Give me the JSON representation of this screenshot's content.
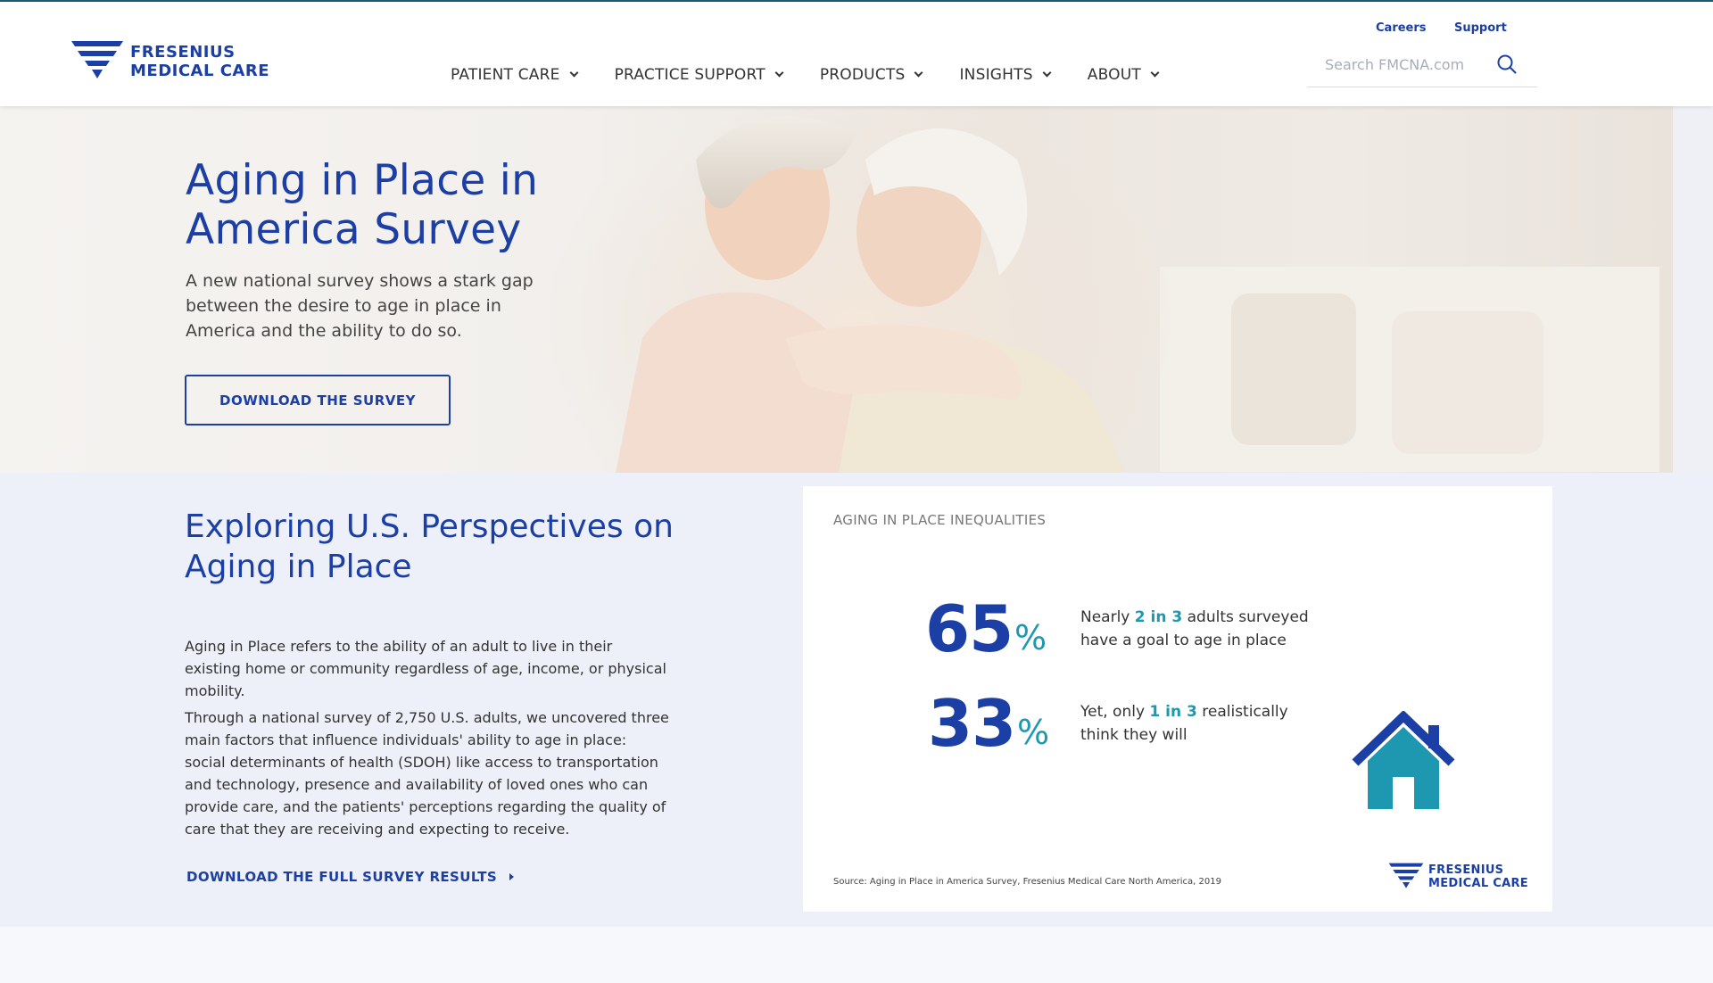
{
  "brand": {
    "line1": "FRESENIUS",
    "line2": "MEDICAL CARE",
    "color": "#1b3fa5",
    "accent": "#1e98b0"
  },
  "utility_links": {
    "careers": "Careers",
    "support": "Support"
  },
  "nav": {
    "items": [
      {
        "label": "PATIENT CARE"
      },
      {
        "label": "PRACTICE SUPPORT"
      },
      {
        "label": "PRODUCTS"
      },
      {
        "label": "INSIGHTS"
      },
      {
        "label": "ABOUT"
      }
    ]
  },
  "search": {
    "placeholder": "Search FMCNA.com",
    "value": ""
  },
  "hero": {
    "title_line1": "Aging in Place in",
    "title_line2": "America Survey",
    "subtitle": "A new national survey shows a stark gap between the desire to age in place in America and the ability to do so.",
    "button_label": "DOWNLOAD THE SURVEY"
  },
  "info": {
    "title": "Exploring U.S. Perspectives on Aging in Place",
    "paragraph1": "Aging in Place refers to the ability of an adult to live in their existing home or community regardless of age, income, or physical mobility.",
    "paragraph2": "Through a national survey of 2,750 U.S. adults, we uncovered three main factors that influence individuals' ability to age in place: social determinants of health (SDOH) like access to transportation and technology, presence and availability of loved ones who can provide care, and the patients' perceptions regarding the quality of care that they are receiving and expecting to receive.",
    "link_label": "DOWNLOAD THE FULL SURVEY RESULTS"
  },
  "card": {
    "heading": "AGING IN PLACE INEQUALITIES",
    "stats": [
      {
        "number": "65",
        "unit": "%",
        "pre": "Nearly ",
        "highlight": "2 in 3",
        "post": " adults surveyed have a goal to age in place"
      },
      {
        "number": "33",
        "unit": "%",
        "pre": "Yet, only ",
        "highlight": "1 in 3",
        "post": " realistically think they will"
      }
    ],
    "source": "Source: Aging in Place in America Survey, Fresenius Medical Care North America, 2019",
    "icon": "house-icon"
  }
}
